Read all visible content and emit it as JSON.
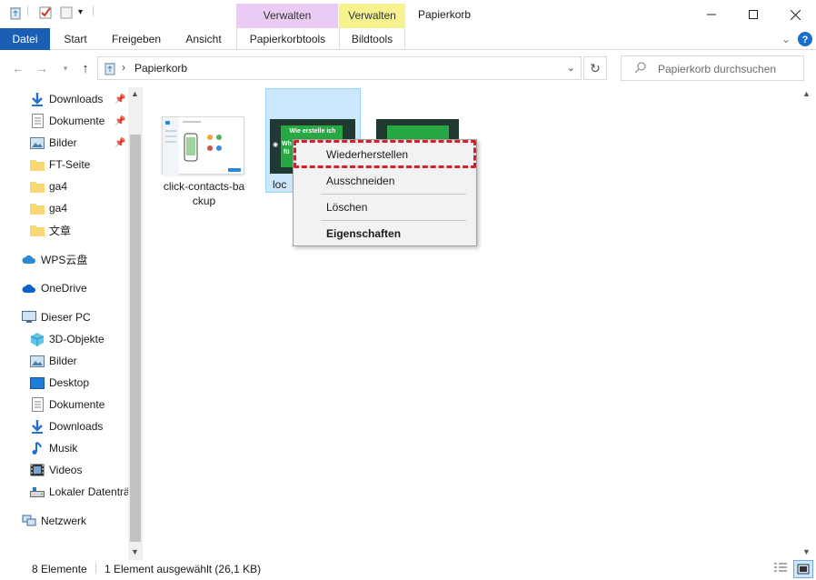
{
  "title_bar": {
    "context_tab_manage_1": "Verwalten",
    "context_tab_manage_2": "Verwalten",
    "window_title": "Papierkorb"
  },
  "ribbon": {
    "tabs": [
      "Datei",
      "Start",
      "Freigeben",
      "Ansicht",
      "Papierkorbtools",
      "Bildtools"
    ]
  },
  "address": {
    "path": "Papierkorb",
    "search_placeholder": "Papierkorb durchsuchen"
  },
  "nav": {
    "quick_access": [
      {
        "label": "Downloads",
        "icon": "download-icon",
        "pinned": true
      },
      {
        "label": "Dokumente",
        "icon": "document-icon",
        "pinned": true
      },
      {
        "label": "Bilder",
        "icon": "pictures-icon",
        "pinned": true
      },
      {
        "label": "FT-Seite",
        "icon": "folder-icon",
        "pinned": false
      },
      {
        "label": "ga4",
        "icon": "folder-icon",
        "pinned": false
      },
      {
        "label": "ga4",
        "icon": "folder-icon",
        "pinned": false
      },
      {
        "label": "文章",
        "icon": "folder-icon",
        "pinned": false
      }
    ],
    "wps": "WPS云盘",
    "onedrive": "OneDrive",
    "this_pc": "Dieser PC",
    "pc_items": [
      {
        "label": "3D-Objekte",
        "icon": "3d-objects-icon"
      },
      {
        "label": "Bilder",
        "icon": "pictures-icon"
      },
      {
        "label": "Desktop",
        "icon": "desktop-icon"
      },
      {
        "label": "Dokumente",
        "icon": "document-icon"
      },
      {
        "label": "Downloads",
        "icon": "download-icon"
      },
      {
        "label": "Musik",
        "icon": "music-icon"
      },
      {
        "label": "Videos",
        "icon": "video-icon"
      },
      {
        "label": "Lokaler Datenträ",
        "icon": "drive-icon"
      }
    ],
    "network": "Netzwerk"
  },
  "files": [
    {
      "caption": "click-contacts-ba\nckup"
    },
    {
      "caption": "loc",
      "thumb_text_1": "Wie erstelle ich",
      "thumb_text_2": "Wh",
      "thumb_text_3": "fü"
    }
  ],
  "context_menu": {
    "restore": "Wiederherstellen",
    "cut": "Ausschneiden",
    "delete": "Löschen",
    "properties": "Eigenschaften"
  },
  "status": {
    "count": "8 Elemente",
    "selection": "1 Element ausgewählt (26,1 KB)"
  },
  "colors": {
    "datei_tab": "#1a5fb4",
    "context_violet": "#e9cbf3",
    "context_yellow": "#f6f38f",
    "selection_fill": "#cce8ff",
    "highlight_border": "#d81e2a"
  }
}
